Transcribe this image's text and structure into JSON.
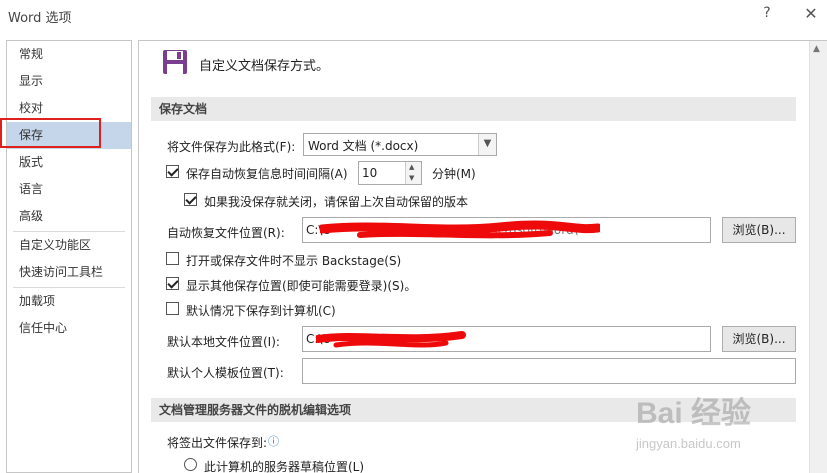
{
  "window": {
    "title": "Word 选项",
    "help_glyph": "?",
    "close_glyph": "✕"
  },
  "sidebar": {
    "items": [
      {
        "label": "常规"
      },
      {
        "label": "显示"
      },
      {
        "label": "校对"
      },
      {
        "label": "保存",
        "selected": true
      },
      {
        "label": "版式"
      },
      {
        "label": "语言"
      },
      {
        "label": "高级"
      },
      {
        "label": "自定义功能区"
      },
      {
        "label": "快速访问工具栏"
      },
      {
        "label": "加载项"
      },
      {
        "label": "信任中心"
      }
    ],
    "highlight_color": "#e0201f",
    "selected_color": "#c5d5ea"
  },
  "main": {
    "header": {
      "icon": "save-icon",
      "icon_color": "#7a3d8f",
      "text": "自定义文档保存方式。"
    },
    "section_save": {
      "title": "保存文档",
      "format_label": "将文件保存为此格式(F):",
      "format_value": "Word 文档 (*.docx)",
      "autorecover_label": "保存自动恢复信息时间间隔(A)",
      "autorecover_checked": true,
      "autorecover_value": "10",
      "autorecover_unit": "分钟(M)",
      "keep_last_label": "如果我没保存就关闭，请保留上次自动保留的版本",
      "keep_last_checked": true,
      "autorecover_location_label": "自动恢复文件位置(R):",
      "autorecover_location_value": "C:\\U",
      "autorecover_location_tail": "...icrosoft\\Word\\",
      "browse1_label": "浏览(B)...",
      "no_backstage_label": "打开或保存文件时不显示 Backstage(S)",
      "no_backstage_checked": false,
      "show_other_label": "显示其他保存位置(即使可能需要登录)(S)。",
      "show_other_checked": true,
      "default_computer_label": "默认情况下保存到计算机(C)",
      "default_computer_checked": false,
      "default_local_label": "默认本地文件位置(I):",
      "default_local_value": "C:\\U",
      "browse2_label": "浏览(B)...",
      "default_template_label": "默认个人模板位置(T):",
      "default_template_value": ""
    },
    "section_offline": {
      "title": "文档管理服务器文件的脱机编辑选项",
      "checkout_label": "将签出文件保存到:",
      "info_glyph": "ⓘ",
      "radio1_label": "此计算机的服务器草稿位置(L)"
    }
  },
  "watermark": {
    "text": "Bai 经验",
    "sub": "jingyan.baidu.com"
  }
}
